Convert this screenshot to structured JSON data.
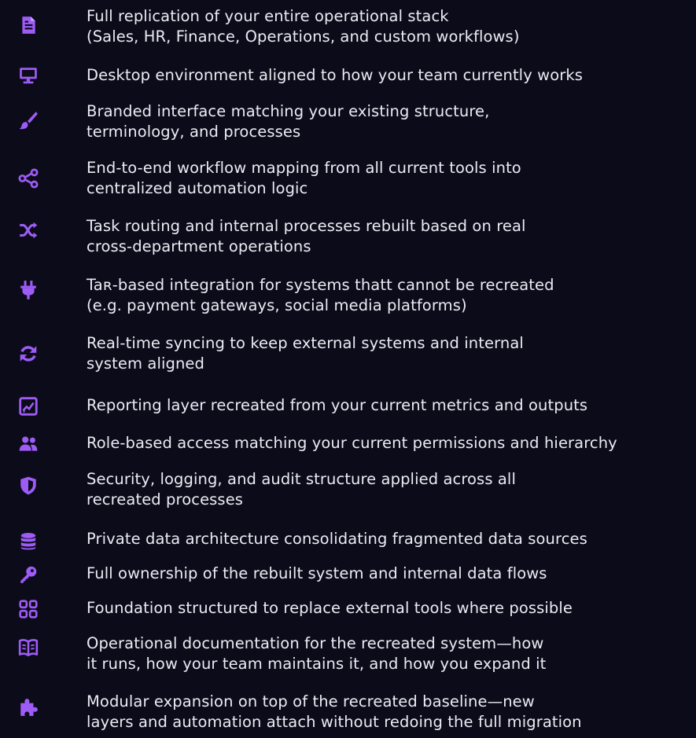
{
  "accent_color": "#9d5cf5",
  "features": [
    {
      "icon": "document-icon",
      "lines": [
        "Full replication of your entire operational stack",
        "(Sales, HR, Finance, Operations, and custom workflows)"
      ]
    },
    {
      "icon": "desktop-monitor-icon",
      "lines": [
        "Desktop environment aligned to how your team currently works"
      ]
    },
    {
      "icon": "paint-brush-icon",
      "lines": [
        "Branded interface matching your existing structure,",
        "terminology, and processes"
      ]
    },
    {
      "icon": "share-nodes-icon",
      "lines": [
        "End-to-end workflow mapping from all current tools into",
        "centralized automation logic"
      ]
    },
    {
      "icon": "shuffle-icon",
      "lines": [
        "Task routing and internal processes rebuilt based on real",
        "cross-department operations"
      ]
    },
    {
      "icon": "plug-icon",
      "lines": [
        "Taʀ-based integration for systems thatt cannot be recreated",
        "(e.g. payment gateways, social media platforms)"
      ]
    },
    {
      "icon": "sync-icon",
      "lines": [
        "Real-time syncing to keep external systems and internal",
        "system aligned"
      ]
    },
    {
      "icon": "chart-report-icon",
      "lines": [
        "Reporting layer recreated from your current metrics and outputs"
      ]
    },
    {
      "icon": "users-icon",
      "lines": [
        "Role-based access matching your current permissions and hierarchy"
      ]
    },
    {
      "icon": "shield-icon",
      "lines": [
        "Security, logging, and audit structure applied across all",
        "recreated processes"
      ]
    },
    {
      "icon": "database-icon",
      "lines": [
        "Private data architecture consolidating fragmented data sources"
      ]
    },
    {
      "icon": "key-icon",
      "lines": [
        "Full ownership of the rebuilt system and internal data flows"
      ]
    },
    {
      "icon": "grid-apps-icon",
      "lines": [
        "Foundation structured to replace external tools where possible"
      ]
    },
    {
      "icon": "book-open-icon",
      "lines": [
        "Operational documentation for the recreated system—how",
        "it runs, how your team maintains it, and how you expand it"
      ]
    },
    {
      "icon": "puzzle-piece-icon",
      "lines": [
        "Modular expansion on top of the recreated baseline—new",
        "layers and automation attach without redoing the full migration"
      ]
    }
  ]
}
